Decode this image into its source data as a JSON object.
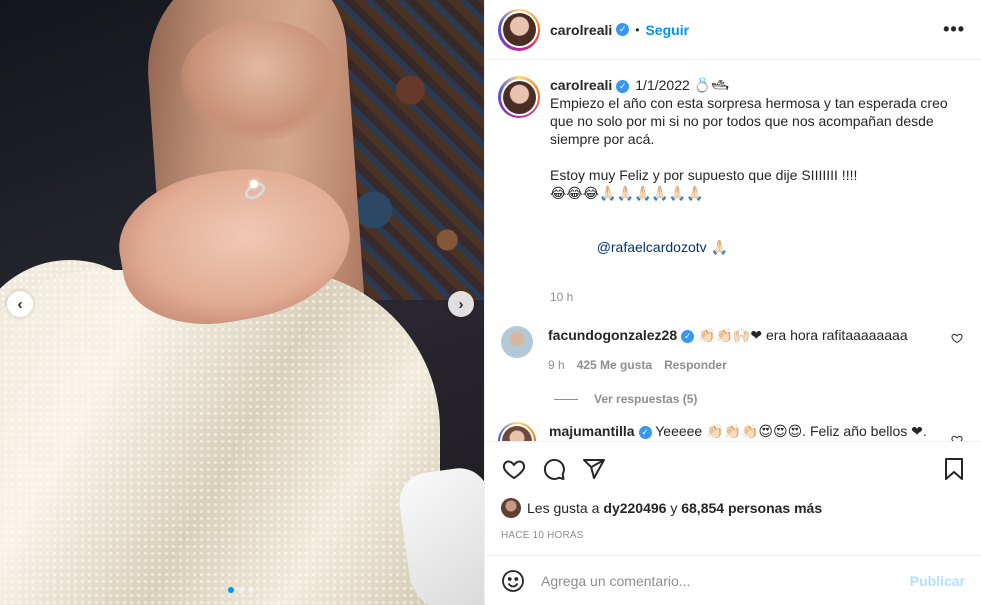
{
  "post": {
    "username": "carolreali",
    "follow_label": "Seguir",
    "bullet": "•",
    "more_label": "•••"
  },
  "caption": {
    "username": "carolreali",
    "date": "1/1/2022 💍🛥",
    "body": "Empiezo el año con esta sorpresa hermosa y tan esperada creo que no solo por mi si no por todos que nos acompañan desde siempre por acá.\n\nEstoy muy Feliz y por supuesto que dije SIIIIIII !!!!\n😂😂😂🙏🏻🙏🏻🙏🏻🙏🏻🙏🏻🙏🏻",
    "mention": "@rafaelcardozotv",
    "mention_suffix": " 🙏🏻",
    "time": "10 h"
  },
  "comments": [
    {
      "username": "facundogonzalez28",
      "text": " 👏🏻👏🏻🙌🏻❤ era hora rafitaaaaaaaa",
      "time": "9 h",
      "likes": "425 Me gusta",
      "reply": "Responder",
      "view_replies": "Ver respuestas (5)"
    },
    {
      "username": "majumantilla",
      "text": " Yeeeee 👏🏻👏🏻👏🏻😍😍😍. Feliz año bellos ❤."
    }
  ],
  "likes": {
    "prefix": "Les gusta a ",
    "user": "dy220496",
    "middle": " y ",
    "count": "68,854 personas más"
  },
  "posttime": "HACE 10 HORAS",
  "add_comment": {
    "placeholder": "Agrega un comentario...",
    "publish": "Publicar"
  },
  "carousel": {
    "total_slides": 3,
    "active_slide": 1,
    "prev": "‹",
    "next": "›"
  },
  "colors": {
    "accent": "#0095f6",
    "verified": "#3897f0",
    "mention": "#00376b",
    "muted": "#8e8e8e",
    "publish_disabled": "#b2dffc"
  }
}
